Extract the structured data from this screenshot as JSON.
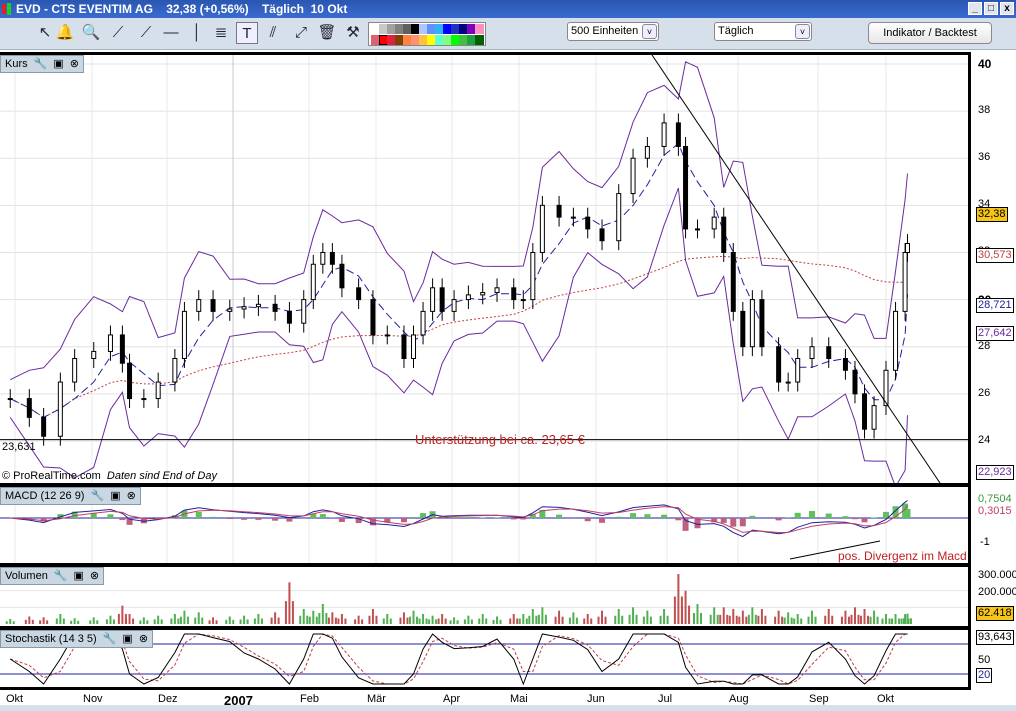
{
  "window": {
    "title": "EVD - CTS EVENTIM AG    32,38 (+0,56%)    Täglich  10 Okt",
    "min": "_",
    "max": "□",
    "close": "x"
  },
  "toolbar": {
    "tools": [
      "cursor-icon",
      "alarm-bell-icon",
      "zoom-icon",
      "line-icon",
      "ray-icon",
      "horizontal-line-icon",
      "vertical-line-icon",
      "fibonacci-icon",
      "text-icon",
      "channel-icon",
      "segment-icon",
      "trash-icon",
      "tools-icon"
    ],
    "tool_glyphs": [
      "↖",
      "🔔",
      "🔍",
      "⟋",
      "⟋",
      "—",
      "│",
      "≣",
      "T",
      "⫽",
      "⤢",
      "🗑",
      "⚒"
    ],
    "palette": [
      "#ffffff",
      "#c8c8c8",
      "#a0a0a0",
      "#808080",
      "#606060",
      "#000000",
      "#b0c4ff",
      "#6090ff",
      "#30b0ff",
      "#0000ff",
      "#2030c0",
      "#000080",
      "#8000c0",
      "#ff90c0",
      "#e06070",
      "#ff0000",
      "#e02040",
      "#804000",
      "#ff8040",
      "#ff9070",
      "#ffc040",
      "#ffff00",
      "#60ffd0",
      "#80ff80",
      "#00ff00",
      "#40c040",
      "#20a040",
      "#006000"
    ],
    "units_select": "500 Einheiten",
    "period_select": "Täglich",
    "indicator_button": "Indikator / Backtest"
  },
  "price_panel": {
    "title": "Kurs",
    "footer": "© ProRealTime.com",
    "footer_note": "Daten sind End of Day",
    "support_label": "23,631",
    "annotation": "Unterstützung bei ca. 23,65 €",
    "axis_ticks": [
      "40",
      "38",
      "36",
      "34",
      "32",
      "30",
      "28",
      "26",
      "24"
    ],
    "tags": {
      "last": "32,38",
      "ma_long": "30,573",
      "ma_mid": "28,721",
      "band_a": "27,642",
      "band_low": "22,923"
    },
    "colors": {
      "last": "#f5c518",
      "ma_long": "#c04040",
      "ma_mid": "#2020a0",
      "bands": "#6a2aa0",
      "annotation": "#c02020"
    }
  },
  "macd_panel": {
    "title": "MACD (12 26 9)",
    "tags": {
      "macd": "0,7504",
      "signal": "0,3015"
    },
    "axis_ticks": [
      "-1"
    ],
    "annotation": "pos. Divergenz im Macd"
  },
  "volume_panel": {
    "title": "Volumen",
    "axis_ticks": [
      "300.000",
      "200.000"
    ],
    "tag": "62.418"
  },
  "stoch_panel": {
    "title": "Stochastik (14 3 5)",
    "axis_ticks": [
      "50"
    ],
    "tags": {
      "k": "93,643",
      "low": "20"
    }
  },
  "x_axis": {
    "labels": [
      "Okt",
      "Nov",
      "Dez",
      "2007",
      "Feb",
      "Mär",
      "Apr",
      "Mai",
      "Jun",
      "Jul",
      "Aug",
      "Sep",
      "Okt"
    ]
  },
  "chart_data": {
    "type": "candlestick",
    "ylim": [
      22.5,
      40.5
    ],
    "xlim": [
      "2006-10-01",
      "2007-10-10"
    ],
    "grid": true,
    "x": [
      "2006-09-29",
      "2006-10-07",
      "2006-10-13",
      "2006-10-20",
      "2006-10-26",
      "2006-11-03",
      "2006-11-10",
      "2006-11-15",
      "2006-11-18",
      "2006-11-24",
      "2006-11-30",
      "2006-12-07",
      "2006-12-11",
      "2006-12-17",
      "2006-12-23",
      "2006-12-30",
      "2007-01-05",
      "2007-01-11",
      "2007-01-18",
      "2007-01-24",
      "2007-01-30",
      "2007-02-03",
      "2007-02-07",
      "2007-02-11",
      "2007-02-15",
      "2007-02-22",
      "2007-02-28",
      "2007-03-06",
      "2007-03-13",
      "2007-03-17",
      "2007-03-21",
      "2007-03-25",
      "2007-03-29",
      "2007-04-03",
      "2007-04-09",
      "2007-04-15",
      "2007-04-21",
      "2007-04-28",
      "2007-05-02",
      "2007-05-06",
      "2007-05-10",
      "2007-05-17",
      "2007-05-23",
      "2007-05-29",
      "2007-06-04",
      "2007-06-11",
      "2007-06-17",
      "2007-06-23",
      "2007-06-30",
      "2007-07-06",
      "2007-07-09",
      "2007-07-14",
      "2007-07-21",
      "2007-07-25",
      "2007-07-29",
      "2007-08-02",
      "2007-08-06",
      "2007-08-10",
      "2007-08-17",
      "2007-08-21",
      "2007-08-25",
      "2007-08-31",
      "2007-09-07",
      "2007-09-14",
      "2007-09-18",
      "2007-09-22",
      "2007-09-26",
      "2007-10-01",
      "2007-10-05",
      "2007-10-09",
      "2007-10-10"
    ],
    "close": [
      25.8,
      25.0,
      24.2,
      26.5,
      27.5,
      27.8,
      28.5,
      27.3,
      25.8,
      25.8,
      26.5,
      27.5,
      29.5,
      30.0,
      29.5,
      29.6,
      29.7,
      29.8,
      29.5,
      29.0,
      30.0,
      31.5,
      32.0,
      31.5,
      30.5,
      30.0,
      28.5,
      28.5,
      27.5,
      28.5,
      29.5,
      30.5,
      29.5,
      30.0,
      30.2,
      30.3,
      30.5,
      30.0,
      30.0,
      32.0,
      34.0,
      33.5,
      33.5,
      33.0,
      32.5,
      34.5,
      36.0,
      36.5,
      37.5,
      36.5,
      33.0,
      33.0,
      33.5,
      32.0,
      29.5,
      28.0,
      30.0,
      28.0,
      26.5,
      26.5,
      27.5,
      28.0,
      27.5,
      27.0,
      26.0,
      24.5,
      25.5,
      27.0,
      29.5,
      32.0,
      32.38
    ],
    "volume": [
      30000,
      45000,
      40000,
      60000,
      35000,
      40000,
      50000,
      110000,
      60000,
      40000,
      50000,
      60000,
      80000,
      70000,
      40000,
      45000,
      50000,
      60000,
      70000,
      250000,
      90000,
      80000,
      120000,
      70000,
      60000,
      50000,
      90000,
      60000,
      70000,
      80000,
      60000,
      50000,
      60000,
      40000,
      50000,
      60000,
      45000,
      60000,
      60000,
      90000,
      100000,
      80000,
      70000,
      60000,
      80000,
      90000,
      100000,
      80000,
      90000,
      300000,
      200000,
      120000,
      100000,
      100000,
      90000,
      80000,
      100000,
      90000,
      80000,
      70000,
      60000,
      80000,
      90000,
      80000,
      100000,
      90000,
      80000,
      60000,
      60000,
      60000,
      62418
    ]
  }
}
